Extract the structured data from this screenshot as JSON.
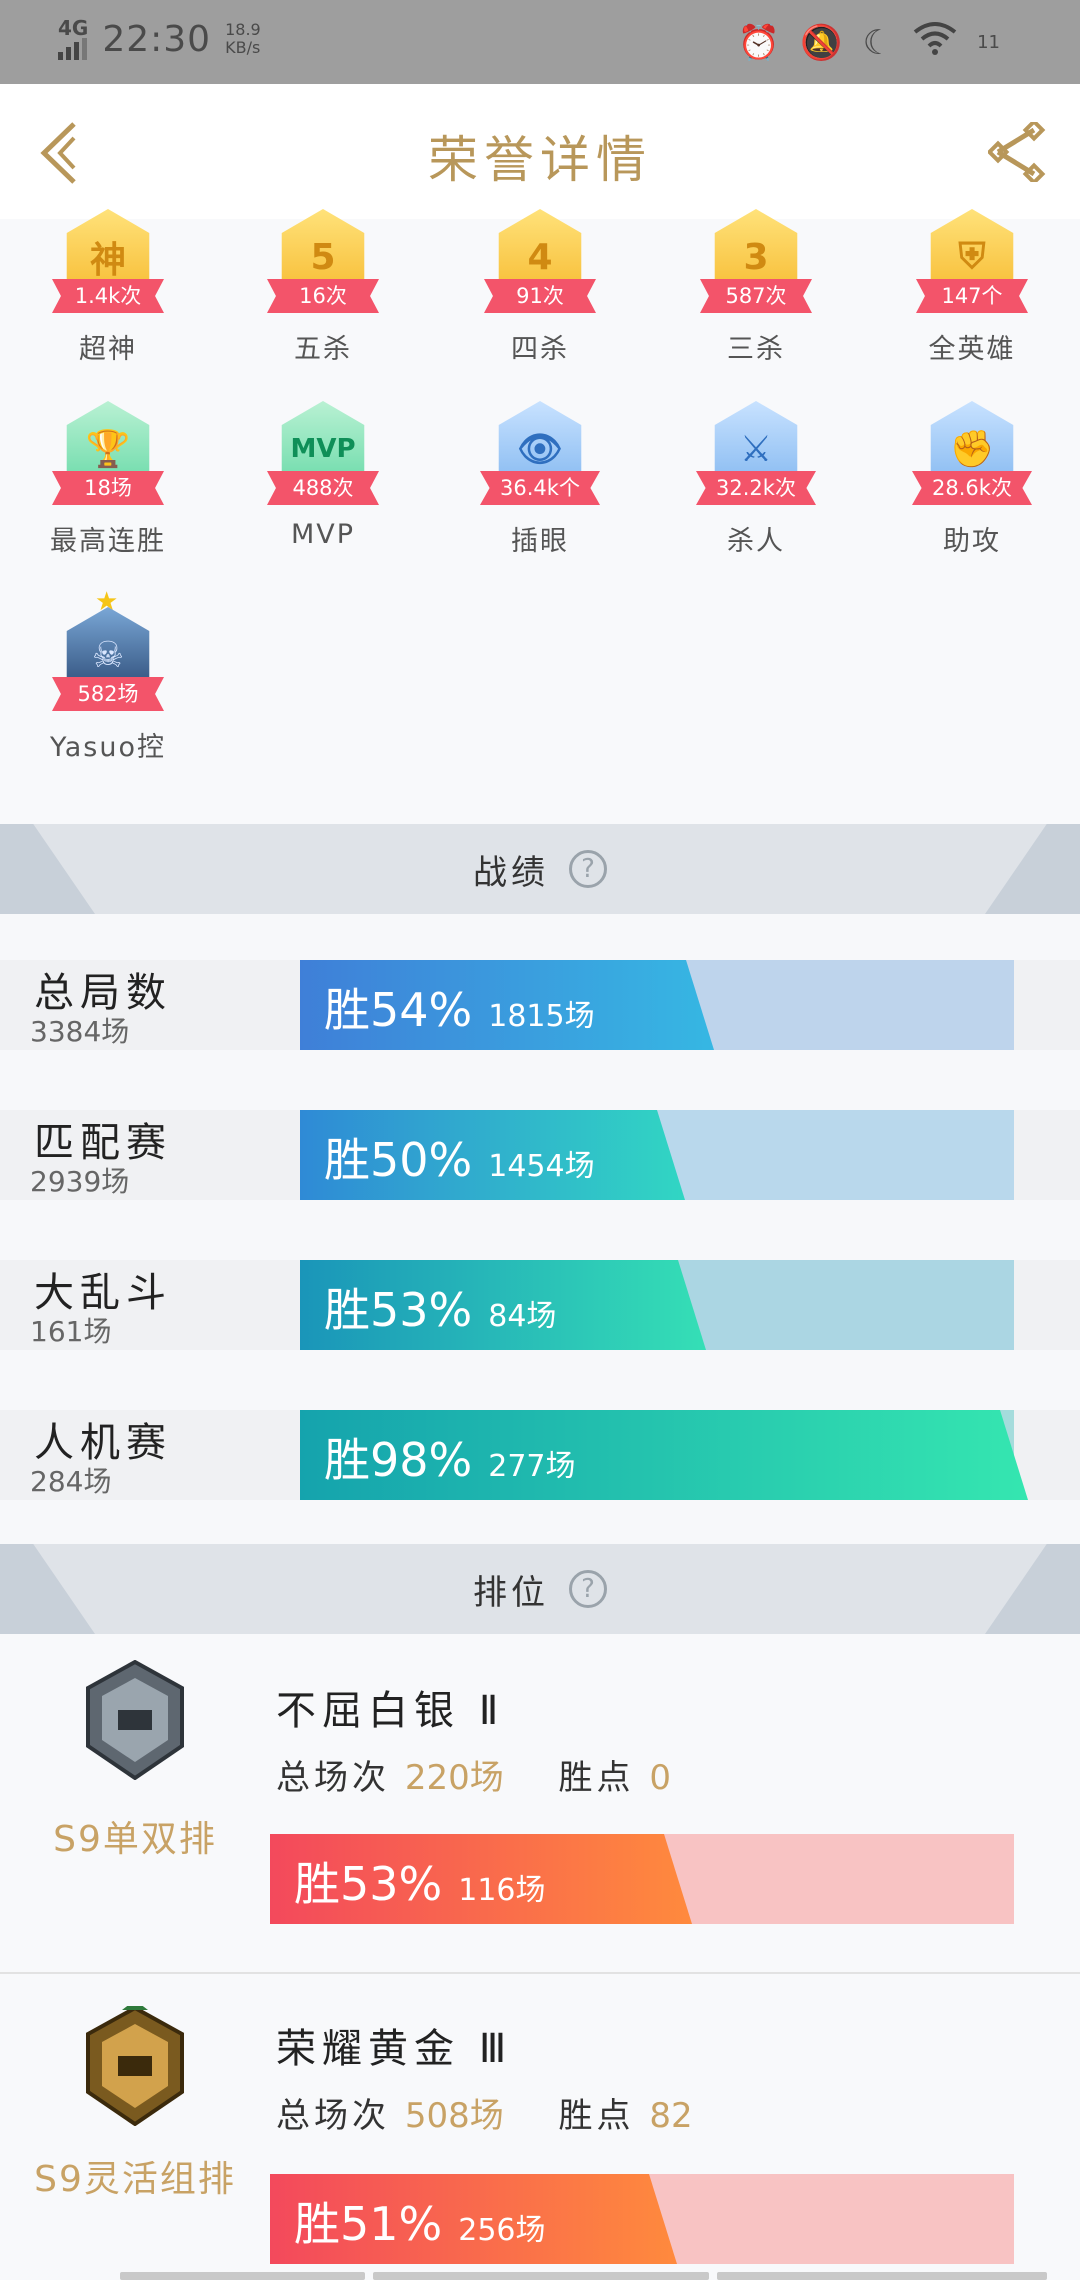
{
  "status": {
    "network": "4G",
    "time": "22:30",
    "speed_value": "18.9",
    "speed_unit": "KB/s",
    "battery": "11"
  },
  "header": {
    "title": "荣誉详情"
  },
  "badges": [
    {
      "glyph": "神",
      "count": "1.4k次",
      "label": "超神",
      "color": "gold"
    },
    {
      "glyph": "5",
      "count": "16次",
      "label": "五杀",
      "color": "gold"
    },
    {
      "glyph": "4",
      "count": "91次",
      "label": "四杀",
      "color": "gold"
    },
    {
      "glyph": "3",
      "count": "587次",
      "label": "三杀",
      "color": "gold"
    },
    {
      "glyph": "⛨",
      "count": "147个",
      "label": "全英雄",
      "color": "gold"
    },
    {
      "glyph": "🏆",
      "count": "18场",
      "label": "最高连胜",
      "color": "green"
    },
    {
      "glyph": "MVP",
      "count": "488次",
      "label": "MVP",
      "color": "green"
    },
    {
      "glyph": "👁",
      "count": "36.4k个",
      "label": "插眼",
      "color": "blue"
    },
    {
      "glyph": "⚔",
      "count": "32.2k次",
      "label": "杀人",
      "color": "blue"
    },
    {
      "glyph": "✊",
      "count": "28.6k次",
      "label": "助攻",
      "color": "blue"
    },
    {
      "glyph": "☠",
      "count": "582场",
      "label": "Yasuo控",
      "color": "dark"
    }
  ],
  "records_section": {
    "title": "战绩",
    "help": "?"
  },
  "records": [
    {
      "name": "总局数",
      "count": "3384场",
      "pct_label": "胜54%",
      "wins": "1815场",
      "win_rate": 0.54
    },
    {
      "name": "匹配赛",
      "count": "2939场",
      "pct_label": "胜50%",
      "wins": "1454场",
      "win_rate": 0.5
    },
    {
      "name": "大乱斗",
      "count": "161场",
      "pct_label": "胜53%",
      "wins": "84场",
      "win_rate": 0.53
    },
    {
      "name": "人机赛",
      "count": "284场",
      "pct_label": "胜98%",
      "wins": "277场",
      "win_rate": 0.98
    }
  ],
  "rank_section": {
    "title": "排位",
    "help": "?"
  },
  "ranks": [
    {
      "season": "S9单双排",
      "tier": "不屈白银 Ⅱ",
      "total_label": "总场次",
      "total": "220场",
      "points_label": "胜点",
      "points": "0",
      "pct_label": "胜53%",
      "wins": "116场",
      "win_rate": 0.53,
      "emblem": "silver"
    },
    {
      "season": "S9灵活组排",
      "tier": "荣耀黄金 Ⅲ",
      "total_label": "总场次",
      "total": "508场",
      "points_label": "胜点",
      "points": "82",
      "pct_label": "胜51%",
      "wins": "256场",
      "win_rate": 0.51,
      "emblem": "gold"
    }
  ],
  "colors": {
    "accent_gold": "#b8975a",
    "rank_gold": "#c8a265",
    "ribbon": "#f3546a"
  }
}
